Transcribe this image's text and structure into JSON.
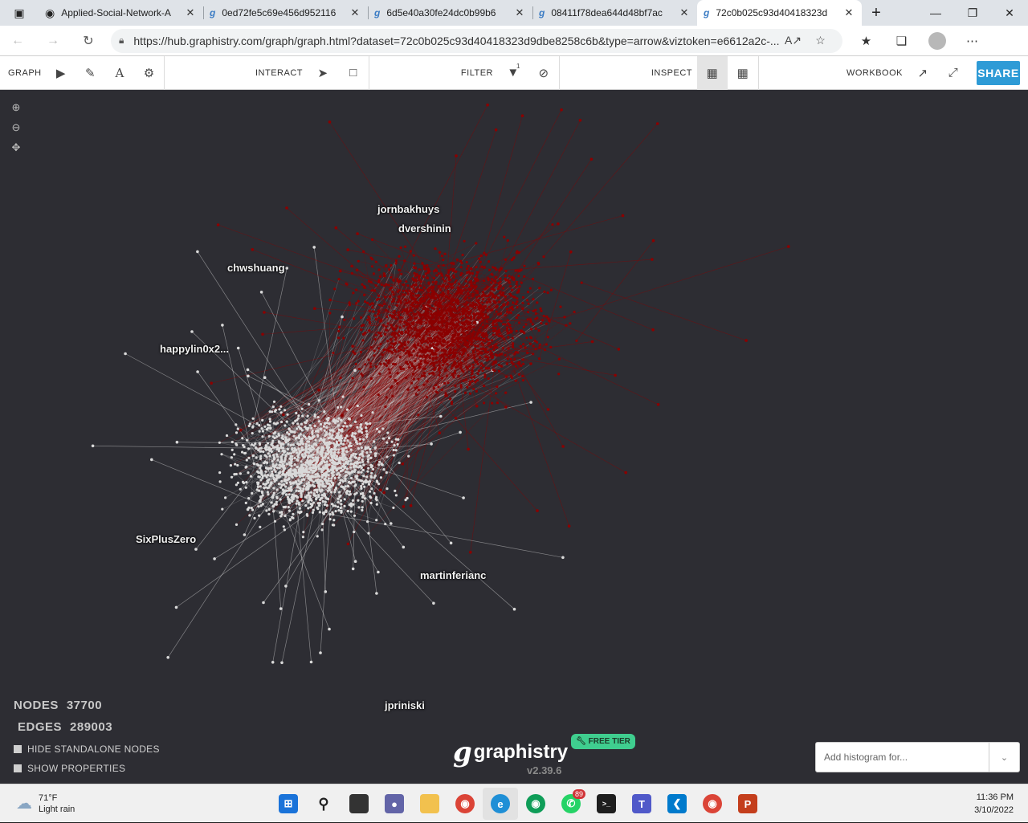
{
  "browser": {
    "tabs": [
      {
        "title": "Applied-Social-Network-A",
        "icon": "github-icon"
      },
      {
        "title": "0ed72fe5c69e456d952116",
        "icon": "graphistry-icon"
      },
      {
        "title": "6d5e40a30fe24dc0b99b6",
        "icon": "graphistry-icon"
      },
      {
        "title": "08411f78dea644d48bf7ac",
        "icon": "graphistry-icon"
      },
      {
        "title": "72c0b025c93d40418323d",
        "icon": "graphistry-icon",
        "active": true
      }
    ],
    "url": "https://hub.graphistry.com/graph/graph.html?dataset=72c0b025c93d40418323d9dbe8258c6b&type=arrow&viztoken=e6612a2c-..."
  },
  "toolbar": {
    "graph_label": "GRAPH",
    "interact_label": "INTERACT",
    "filter_label": "FILTER",
    "filter_count": "1",
    "inspect_label": "INSPECT",
    "workbook_label": "WORKBOOK",
    "share_label": "SHARE"
  },
  "graph": {
    "labels": {
      "l1": "jornbakhuys",
      "l2": "dvershinin",
      "l3": "chwshuang",
      "l4": "happylin0x2...",
      "l5": "SixPlusZero",
      "l6": "martinferianc",
      "l7": "jpriniski"
    },
    "colors": {
      "background": "#2d2d33",
      "cluster_a": "#8b0000",
      "cluster_b": "#d9d9d9"
    }
  },
  "stats": {
    "nodes_label": "NODES",
    "nodes_value": "37700",
    "edges_label": "EDGES",
    "edges_value": "289003",
    "hide_standalone": "HIDE STANDALONE NODES",
    "show_properties": "SHOW PROPERTIES"
  },
  "brand": {
    "mark": "g",
    "name": "graphistry",
    "version": "v2.39.6",
    "tier": "FREE TIER"
  },
  "histogram": {
    "placeholder": "Add histogram for..."
  },
  "taskbar": {
    "temp": "71°F",
    "condition": "Light rain",
    "whatsapp_badge": "89",
    "time": "11:36 PM",
    "date": "3/10/2022"
  }
}
